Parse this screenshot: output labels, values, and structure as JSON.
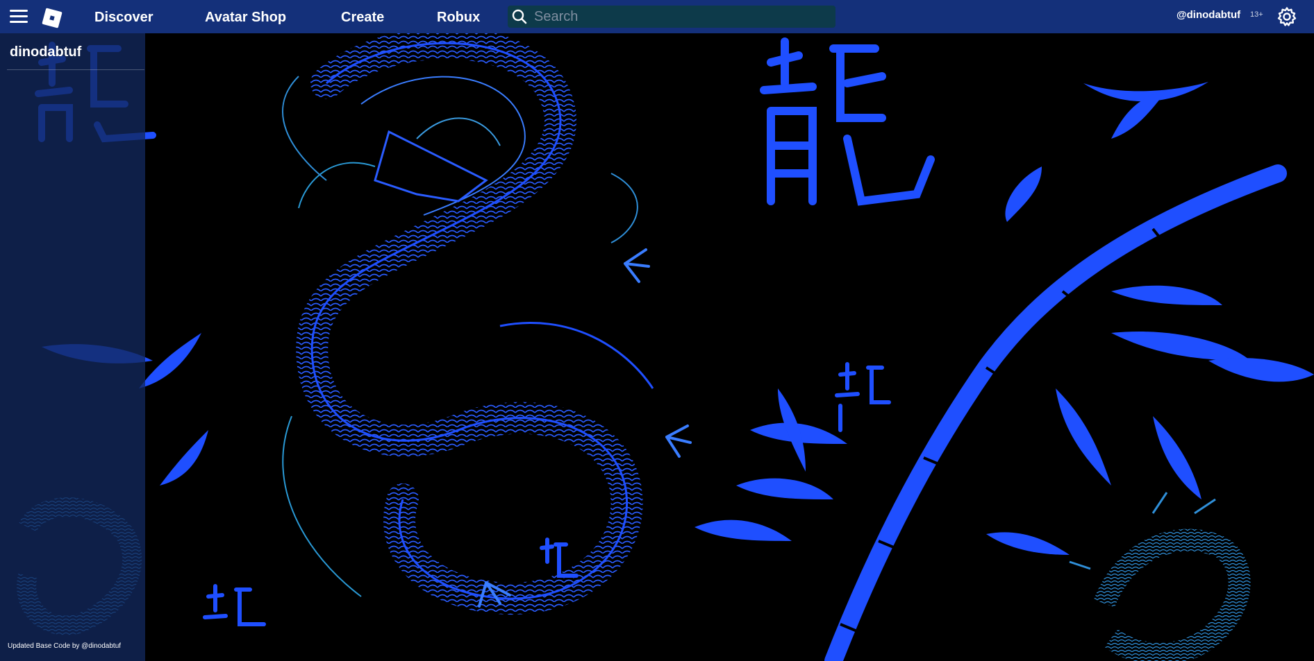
{
  "header": {
    "nav": {
      "discover": "Discover",
      "avatar_shop": "Avatar Shop",
      "create": "Create",
      "robux": "Robux"
    },
    "search": {
      "placeholder": "Search",
      "value": ""
    },
    "username": "@dinodabtuf",
    "age_badge": "13+",
    "icons": {
      "menu": "hamburger-menu-icon",
      "logo": "roblox-logo",
      "search": "search-icon",
      "settings": "gear-icon"
    }
  },
  "sidebar": {
    "username": "dinodabtuf",
    "footer": "Updated Base Code by @dinodabtuf"
  },
  "background": {
    "description_colors": {
      "base": "#000000",
      "art_primary": "#1f4fff",
      "art_secondary": "#2a9ad6"
    }
  },
  "colors": {
    "topbar": "#14307a",
    "sidebar": "#12285c",
    "search_bg": "#0d3a4a",
    "text": "#ffffff"
  }
}
